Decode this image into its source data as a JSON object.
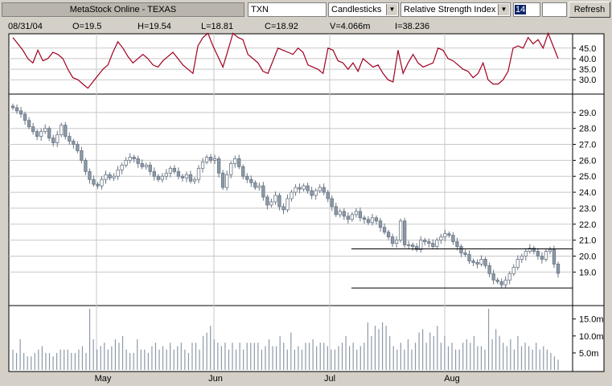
{
  "toolbar": {
    "title": "MetaStock Online - TEXAS",
    "symbol": "TXN",
    "chart_style": "Candlesticks",
    "indicator": "Relative Strength Index",
    "period": "14",
    "extra": "",
    "refresh_label": "Refresh"
  },
  "quote": {
    "date": "08/31/04",
    "open": "O=19.5",
    "high": "H=19.54",
    "low": "L=18.81",
    "close": "C=18.92",
    "volume": "V=4.066m",
    "interest": "I=38.236"
  },
  "colors": {
    "rsi_line": "#a00020",
    "candle_fill": "#8c99a8",
    "volume_bar": "#8c99a8",
    "grid": "#c8c8c8"
  },
  "chart_data": [
    {
      "type": "line",
      "panel": "Relative Strength Index",
      "ylim": [
        24,
        51
      ],
      "yticks": [
        "45.0",
        "40.0",
        "35.0",
        "30.0"
      ],
      "values": [
        50,
        47,
        44,
        40,
        38,
        44,
        39,
        40,
        43,
        42,
        40,
        35,
        31,
        30,
        28,
        26,
        29,
        32,
        35,
        37,
        43,
        48,
        45,
        41,
        38,
        40,
        42,
        40,
        37,
        36,
        39,
        41,
        43,
        40,
        37,
        35,
        33,
        46,
        50,
        52,
        46,
        41,
        36,
        44,
        52,
        50,
        49,
        42,
        40,
        38,
        34,
        33,
        39,
        45,
        44,
        43,
        42,
        45,
        43,
        37,
        36,
        35,
        33,
        45,
        44,
        39,
        38,
        35,
        38,
        34,
        40,
        38,
        36,
        37,
        33,
        30,
        29,
        44,
        33,
        38,
        42,
        38,
        36,
        37,
        38,
        45,
        44,
        40,
        39,
        37,
        35,
        34,
        31,
        33,
        38,
        30,
        28,
        28,
        30,
        34,
        45,
        46,
        45,
        50,
        47,
        49,
        45,
        52,
        46,
        40
      ]
    },
    {
      "type": "candlestick",
      "panel": "price",
      "ylim": [
        17,
        30
      ],
      "yticks": [
        "29.0",
        "28.0",
        "27.0",
        "26.0",
        "25.0",
        "24.0",
        "23.0",
        "22.0",
        "21.0",
        "20.0",
        "19.0"
      ],
      "xticks": [
        "May",
        "Jun",
        "Jul",
        "Aug"
      ],
      "closes": [
        29.3,
        29.1,
        28.9,
        28.5,
        28.1,
        27.8,
        27.5,
        27.8,
        28.0,
        27.4,
        27.1,
        27.6,
        28.2,
        27.5,
        27.2,
        27.0,
        26.6,
        26.0,
        25.3,
        24.8,
        24.5,
        24.4,
        24.8,
        25.1,
        24.9,
        25.0,
        25.4,
        25.7,
        26.0,
        26.2,
        26.1,
        25.8,
        25.6,
        25.7,
        25.3,
        25.0,
        24.8,
        25.0,
        25.2,
        25.5,
        25.3,
        25.0,
        24.9,
        25.1,
        24.7,
        24.8,
        25.5,
        25.9,
        26.2,
        26.0,
        26.1,
        25.2,
        24.3,
        25.1,
        25.8,
        26.1,
        25.6,
        25.0,
        24.8,
        24.6,
        24.3,
        24.4,
        23.7,
        23.2,
        23.4,
        23.8,
        23.1,
        22.9,
        23.6,
        24.0,
        24.3,
        24.2,
        24.4,
        24.1,
        23.8,
        24.1,
        24.3,
        24.0,
        23.6,
        23.1,
        22.6,
        22.8,
        22.5,
        22.3,
        22.6,
        22.8,
        22.4,
        22.3,
        22.1,
        22.4,
        22.2,
        21.8,
        21.5,
        21.2,
        20.8,
        21.0,
        22.2,
        20.7,
        20.7,
        20.6,
        20.4,
        21.0,
        20.9,
        20.8,
        20.6,
        21.0,
        21.2,
        21.4,
        21.3,
        20.9,
        20.6,
        20.2,
        20.1,
        19.7,
        19.6,
        19.5,
        19.8,
        19.4,
        18.9,
        18.5,
        18.4,
        18.2,
        18.5,
        18.9,
        19.3,
        19.8,
        20.0,
        20.3,
        20.5,
        20.3,
        20.0,
        19.8,
        20.3,
        20.4,
        19.5,
        18.92
      ],
      "reference_lines": [
        20.45,
        18.0
      ]
    },
    {
      "type": "bar",
      "panel": "volume",
      "ylim": [
        0,
        18
      ],
      "yticks": [
        "15.0m",
        "10.0m",
        "5.0m"
      ],
      "values": [
        6,
        5,
        9,
        5,
        4,
        4,
        5,
        6,
        7,
        5,
        5,
        4,
        5,
        6,
        6,
        6,
        5,
        5,
        6,
        7,
        5,
        18,
        9,
        6,
        7,
        8,
        6,
        7,
        9,
        8,
        10,
        6,
        5,
        5,
        9,
        6,
        6,
        5,
        7,
        8,
        6,
        7,
        6,
        8,
        6,
        7,
        8,
        6,
        5,
        8,
        8,
        6,
        10,
        11,
        13,
        9,
        8,
        7,
        8,
        6,
        8,
        6,
        8,
        6,
        8,
        8,
        8,
        8,
        6,
        7,
        9,
        7,
        7,
        10,
        8,
        6,
        11,
        6,
        7,
        6,
        8,
        8,
        9,
        7,
        8,
        8,
        7,
        6,
        6,
        7,
        8,
        10,
        7,
        8,
        6,
        7,
        8,
        14,
        10,
        13,
        12,
        14,
        13,
        10,
        7,
        6,
        8,
        6,
        9,
        6,
        8,
        11,
        12,
        8,
        11,
        10,
        13,
        8,
        10,
        7,
        8,
        6,
        6,
        8,
        9,
        8,
        10,
        7,
        7,
        6,
        18,
        9,
        12,
        10,
        8,
        7,
        9,
        6,
        10,
        7,
        8,
        7,
        6,
        8,
        6,
        7,
        6,
        5,
        4,
        3
      ]
    }
  ]
}
